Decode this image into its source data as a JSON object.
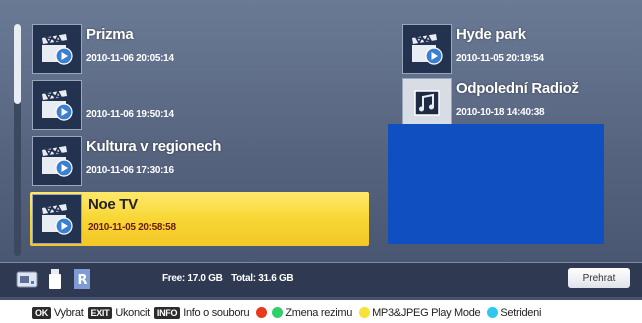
{
  "files": [
    {
      "title": "Prizma",
      "date": "2010-11-06 20:05:14",
      "icon": "video-clapper-icon"
    },
    {
      "title": "",
      "date": "2010-11-06 19:50:14",
      "icon": "video-clapper-icon"
    },
    {
      "title": "Kultura v regionech",
      "date": "2010-11-06 17:30:16",
      "icon": "video-clapper-icon"
    },
    {
      "title": "Noe TV",
      "date": "2010-11-05 20:58:58",
      "icon": "video-clapper-icon",
      "selected": true
    },
    {
      "title": "Hyde park",
      "date": "2010-11-05 20:19:54",
      "icon": "video-clapper-icon"
    },
    {
      "title": "Odpolední Radiož",
      "date": "2010-10-18 14:40:38",
      "icon": "music-note-icon"
    }
  ],
  "status": {
    "free": "Free: 17.0 GB",
    "total": "Total: 31.6 GB",
    "play_button": "Prehrat"
  },
  "help": {
    "ok_key": "OK",
    "ok_label": "Vybrat",
    "exit_key": "EXIT",
    "exit_label": "Ukoncit",
    "info_key": "INFO",
    "info_label": "Info o souboru",
    "mode_label": "Zmena rezimu",
    "play_mode_label": "MP3&JPEG Play Mode",
    "sort_label": "Setrideni"
  },
  "colors": {
    "red": "#e8391a",
    "green": "#2fd06a",
    "yellow": "#f5e23a",
    "blue": "#2fc7f0",
    "preview_blue": "#0f4fbf",
    "selection_yellow": "#f7d634"
  }
}
